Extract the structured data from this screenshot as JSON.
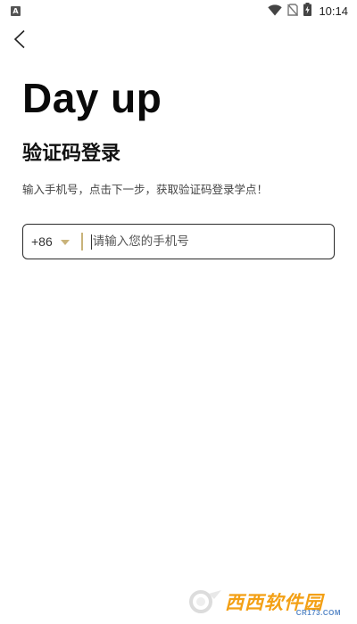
{
  "status_bar": {
    "notification_icon": "app-notification-icon",
    "time": "10:14",
    "icons": [
      "wifi-icon",
      "no-sim-icon",
      "battery-charging-icon"
    ]
  },
  "nav": {
    "back_icon": "back-arrow-icon"
  },
  "brand": {
    "title": "Day up"
  },
  "login": {
    "heading": "验证码登录",
    "subtitle": "输入手机号，点击下一步，获取验证码登录学点！",
    "country_code": "+86",
    "phone_value": "",
    "phone_placeholder": "请输入您的手机号"
  },
  "colors": {
    "accent": "#c9b37a",
    "border": "#2a2a2a"
  },
  "watermark": {
    "brand": "西西软件园",
    "domain": "CR173.COM"
  }
}
